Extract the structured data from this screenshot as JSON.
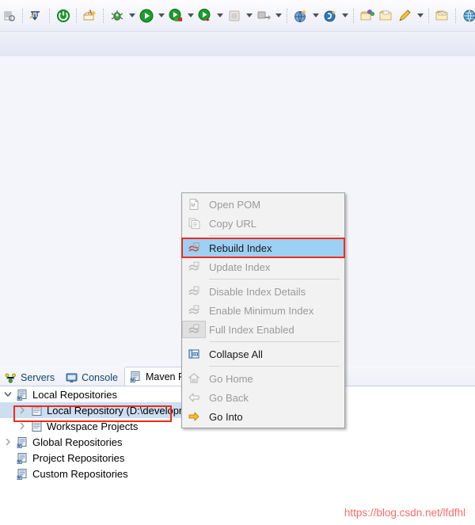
{
  "toolbar": {
    "buttons": [
      {
        "name": "open-type-icon",
        "kind": "icon"
      },
      {
        "name": "skip-breakpoints-icon",
        "kind": "icon"
      },
      {
        "name": "terminate-green-icon",
        "kind": "icon"
      },
      {
        "name": "new-java-project-icon",
        "kind": "icon"
      },
      {
        "name": "debug-bug-icon",
        "kind": "icon"
      },
      {
        "name": "debug-dropdown-arrow",
        "kind": "arrow"
      },
      {
        "name": "run-icon",
        "kind": "icon"
      },
      {
        "name": "run-dropdown-arrow",
        "kind": "arrow"
      },
      {
        "name": "run-external-tools-icon",
        "kind": "icon"
      },
      {
        "name": "external-tools-dropdown-arrow",
        "kind": "arrow"
      },
      {
        "name": "run-coverage-icon",
        "kind": "icon"
      },
      {
        "name": "coverage-dropdown-arrow",
        "kind": "arrow"
      },
      {
        "name": "stop-icon",
        "kind": "icon"
      },
      {
        "name": "stop-dropdown-arrow",
        "kind": "arrow"
      },
      {
        "name": "server-publish-icon",
        "kind": "icon"
      },
      {
        "name": "server-dropdown-arrow",
        "kind": "arrow"
      },
      {
        "name": "new-web-project-icon",
        "kind": "icon"
      },
      {
        "name": "new-web-dropdown-arrow",
        "kind": "arrow"
      },
      {
        "name": "spring-icon",
        "kind": "icon"
      },
      {
        "name": "spring-dropdown-arrow",
        "kind": "arrow"
      },
      {
        "name": "open-perspective-icon",
        "kind": "icon"
      },
      {
        "name": "open-folder-icon",
        "kind": "icon"
      },
      {
        "name": "pen-icon",
        "kind": "icon"
      },
      {
        "name": "pen-dropdown-arrow",
        "kind": "arrow"
      },
      {
        "name": "mail-folder-icon",
        "kind": "icon"
      },
      {
        "name": "globe-icon",
        "kind": "icon"
      },
      {
        "name": "deploy-icon",
        "kind": "icon"
      }
    ]
  },
  "context_menu": {
    "items": [
      {
        "label": "Open POM",
        "icon": "pom-file-icon",
        "state": "disabled"
      },
      {
        "label": "Copy URL",
        "icon": "copy-url-icon",
        "state": "disabled"
      },
      {
        "separator": true
      },
      {
        "label": "Rebuild Index",
        "icon": "rebuild-index-icon",
        "state": "selected"
      },
      {
        "label": "Update Index",
        "icon": "update-index-icon",
        "state": "disabled"
      },
      {
        "separator": true
      },
      {
        "label": "Disable Index Details",
        "icon": "index-details-icon",
        "state": "disabled"
      },
      {
        "label": "Enable Minimum Index",
        "icon": "minimum-index-icon",
        "state": "disabled"
      },
      {
        "label": "Full Index Enabled",
        "icon": "full-index-icon",
        "state": "disabled-toggled"
      },
      {
        "separator": true
      },
      {
        "label": "Collapse All",
        "icon": "collapse-all-icon",
        "state": "enabled"
      },
      {
        "separator": true
      },
      {
        "label": "Go Home",
        "icon": "home-icon",
        "state": "disabled"
      },
      {
        "label": "Go Back",
        "icon": "back-arrow-icon",
        "state": "disabled"
      },
      {
        "label": "Go Into",
        "icon": "go-into-arrow-icon",
        "state": "enabled"
      }
    ],
    "highlight_color": "#f22a1c",
    "selection_color": "#9cd0f5"
  },
  "bottom_panel": {
    "tabs": [
      {
        "label": "Servers",
        "icon": "servers-icon",
        "active": false
      },
      {
        "label": "Console",
        "icon": "console-icon",
        "active": false
      },
      {
        "label": "Maven Re",
        "icon": "maven-repositories-icon",
        "active": true
      }
    ],
    "tree": [
      {
        "label": "Local Repositories",
        "icon": "maven-repo-icon",
        "twisty": "expanded",
        "indent": 0,
        "selected": false
      },
      {
        "label": "Local Repository (D:\\developmentKit\\Repository)",
        "icon": "repo-icon",
        "twisty": "collapsed",
        "indent": 1,
        "selected": true
      },
      {
        "label": "Workspace Projects",
        "icon": "repo-icon",
        "twisty": "collapsed",
        "indent": 1,
        "selected": false
      },
      {
        "label": "Global Repositories",
        "icon": "maven-repo-icon",
        "twisty": "collapsed",
        "indent": 0,
        "selected": false
      },
      {
        "label": "Project Repositories",
        "icon": "maven-repo-icon",
        "twisty": "none",
        "indent": 0,
        "selected": false
      },
      {
        "label": "Custom Repositories",
        "icon": "maven-repo-icon",
        "twisty": "none",
        "indent": 0,
        "selected": false
      }
    ]
  },
  "watermark": {
    "text": "https://blog.csdn.net/lfdfhl",
    "color": "#fb6b6b"
  }
}
